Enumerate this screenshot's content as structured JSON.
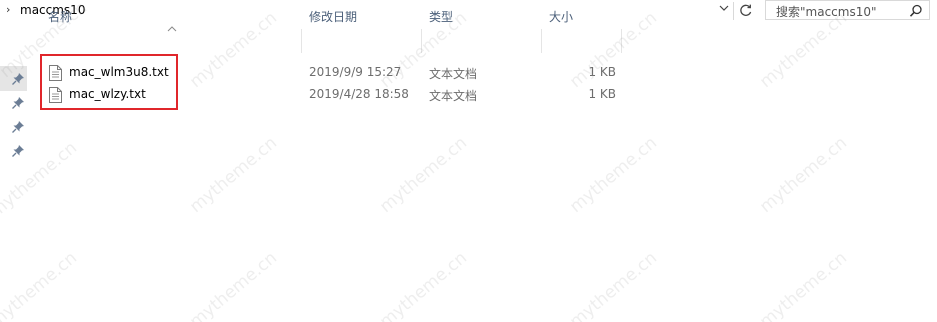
{
  "address": {
    "chevron": "›",
    "path": "maccms10"
  },
  "search": {
    "placeholder": "搜索\"maccms10\""
  },
  "columns": {
    "name": "名称",
    "modified": "修改日期",
    "type": "类型",
    "size": "大小"
  },
  "files": [
    {
      "name": "mac_wlm3u8.txt",
      "modified": "2019/9/9 15:27",
      "type": "文本文档",
      "size": "1 KB"
    },
    {
      "name": "mac_wlzy.txt",
      "modified": "2019/4/28 18:58",
      "type": "文本文档",
      "size": "1 KB"
    }
  ],
  "watermark": "mytheme.cn",
  "colors": {
    "highlight_border": "#e0262b",
    "header_text": "#4c607a",
    "nav_selected": "#e5e5e5"
  }
}
